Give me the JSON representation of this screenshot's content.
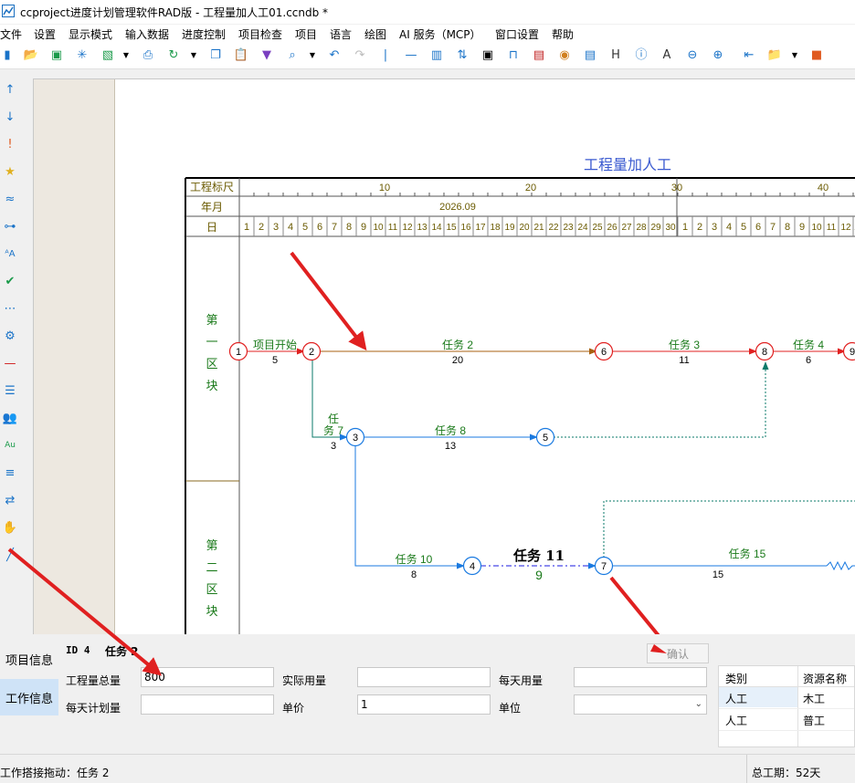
{
  "window": {
    "title": "ccproject进度计划管理软件RAD版 - 工程量加人工01.ccndb *"
  },
  "menu": [
    "文件",
    "设置",
    "显示模式",
    "输入数据",
    "进度控制",
    "项目检查",
    "项目",
    "语言",
    "绘图",
    "AI 服务（MCP）",
    "窗口设置",
    "帮助"
  ],
  "diagram": {
    "title": "工程量加人工",
    "header_rows": [
      "工程标尺",
      "年月",
      "日"
    ],
    "scale_marks": [
      "10",
      "20",
      "30",
      "40"
    ],
    "month": "2026.09",
    "days": [
      "1",
      "2",
      "3",
      "4",
      "5",
      "6",
      "7",
      "8",
      "9",
      "10",
      "11",
      "12",
      "13",
      "14",
      "15",
      "16",
      "17",
      "18",
      "19",
      "20",
      "21",
      "22",
      "23",
      "24",
      "25",
      "26",
      "27",
      "28",
      "29",
      "30",
      "1",
      "2",
      "3",
      "4",
      "5",
      "6",
      "7",
      "8",
      "9",
      "10",
      "11",
      "12"
    ],
    "day_edge": "1",
    "zones": [
      "第一区块",
      "第二区块"
    ],
    "tasks": {
      "t1": {
        "name": "项目开始",
        "dur": "5"
      },
      "t2": {
        "name": "任务 2",
        "dur": "20"
      },
      "t3": {
        "name": "任务 3",
        "dur": "11"
      },
      "t4": {
        "name": "任务 4",
        "dur": "6"
      },
      "t7": {
        "name_a": "任",
        "name_b": "务 7",
        "dur": "3"
      },
      "t8": {
        "name": "任务 8",
        "dur": "13"
      },
      "t10": {
        "name": "任务 10",
        "dur": "8"
      },
      "t11": {
        "name": "任务 11",
        "dur": "9"
      },
      "t15": {
        "name": "任务 15",
        "dur": "15"
      }
    },
    "nodes": [
      "1",
      "2",
      "3",
      "4",
      "5",
      "6",
      "7",
      "8",
      "9"
    ]
  },
  "panel": {
    "tabs": {
      "project": "项目信息",
      "work": "工作信息"
    },
    "id_label": "ID 4",
    "task_label": "任务 2",
    "confirm": "确认",
    "labels": {
      "total_qty": "工程量总量",
      "actual_qty": "实际用量",
      "daily_use": "每天用量",
      "daily_plan": "每天计划量",
      "unit_price": "单价",
      "unit": "单位"
    },
    "values": {
      "total_qty": "800",
      "actual_qty": "",
      "daily_use": "",
      "daily_plan": "",
      "unit_price": "1",
      "unit": ""
    },
    "resources": {
      "headers": [
        "类别",
        "资源名称"
      ],
      "rows": [
        [
          "人工",
          "木工"
        ],
        [
          "人工",
          "普工"
        ]
      ]
    }
  },
  "status": {
    "left": "工作搭接拖动：任务 2",
    "right": "总工期：52天"
  }
}
